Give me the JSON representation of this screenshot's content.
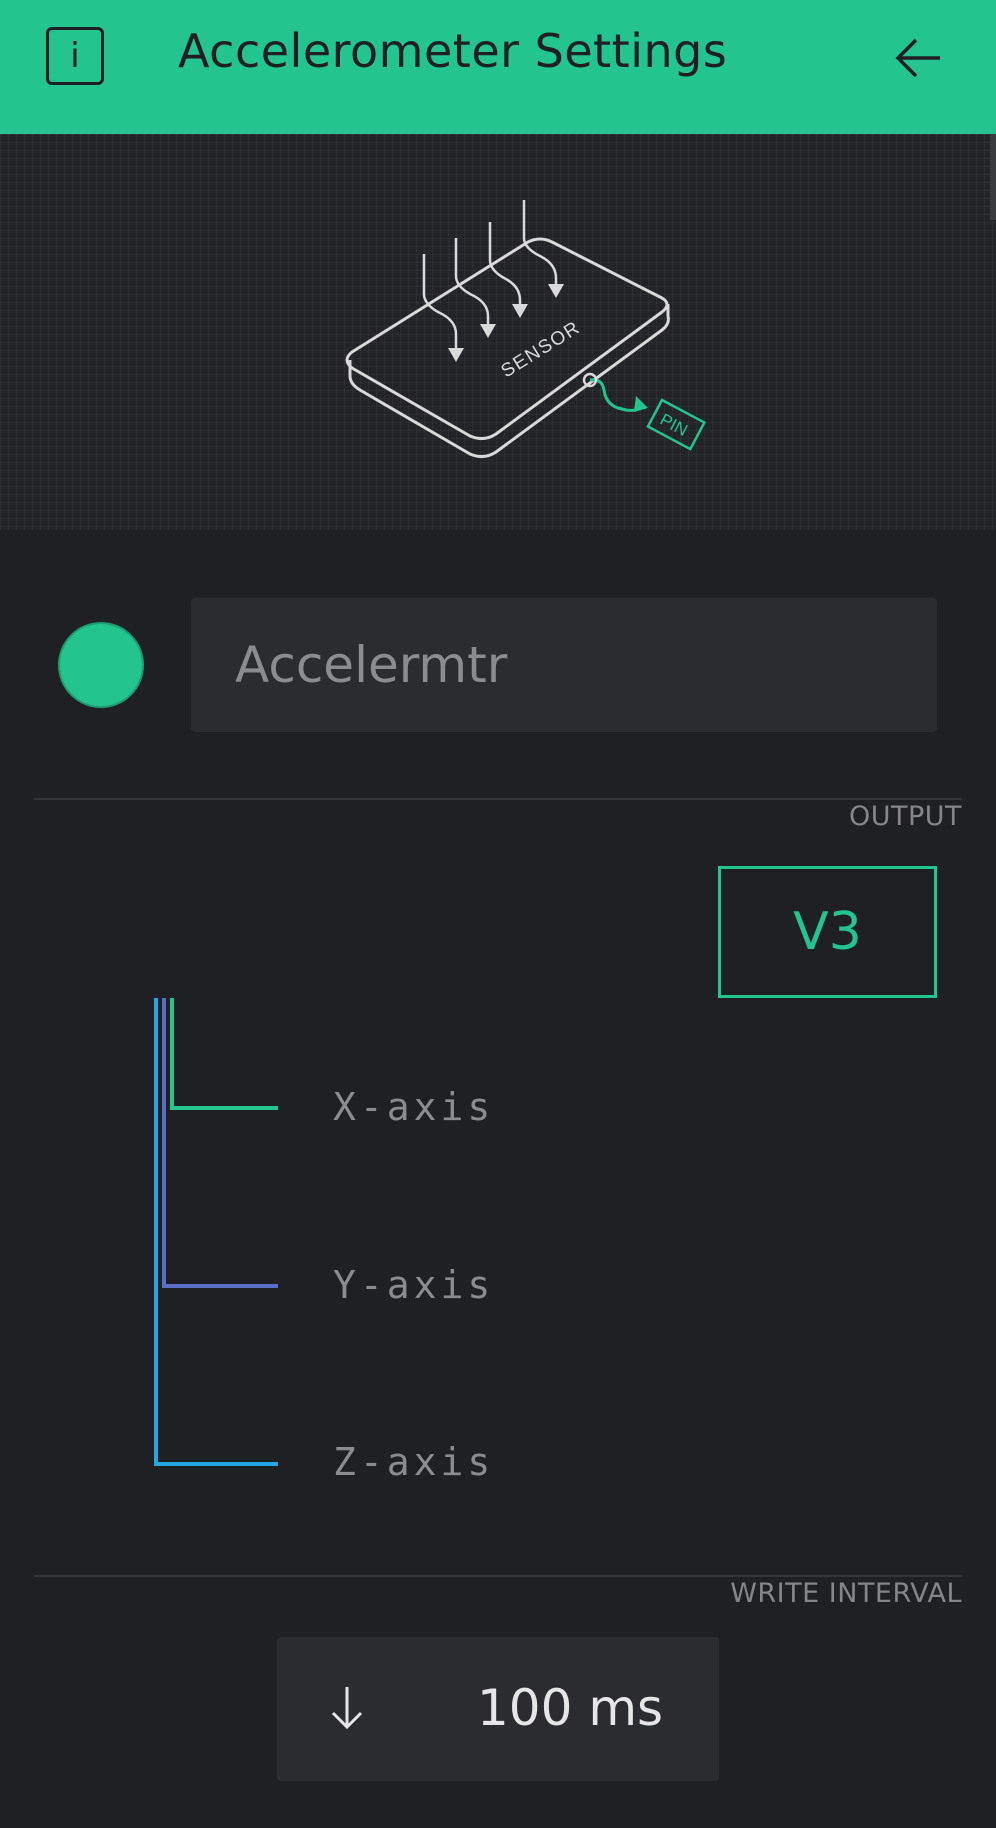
{
  "header": {
    "title": "Accelerometer Settings",
    "info_icon": "info-icon",
    "back_icon": "arrow-left-icon"
  },
  "illustration": {
    "sensor_label": "SENSOR",
    "pin_label": "PIN"
  },
  "widget": {
    "name": "Accelermtr",
    "color": "#23c48e"
  },
  "output": {
    "label": "OUTPUT",
    "pin": "V3",
    "axes": [
      {
        "label": "X-axis",
        "color": "#23c48e"
      },
      {
        "label": "Y-axis",
        "color": "#5b6ec6"
      },
      {
        "label": "Z-axis",
        "color": "#23a7e0"
      }
    ]
  },
  "write_interval": {
    "label": "WRITE INTERVAL",
    "value": "100 ms",
    "icon": "arrow-down-icon"
  },
  "colors": {
    "accent": "#23c48e",
    "background": "#1f2023",
    "field": "#2b2c30"
  }
}
